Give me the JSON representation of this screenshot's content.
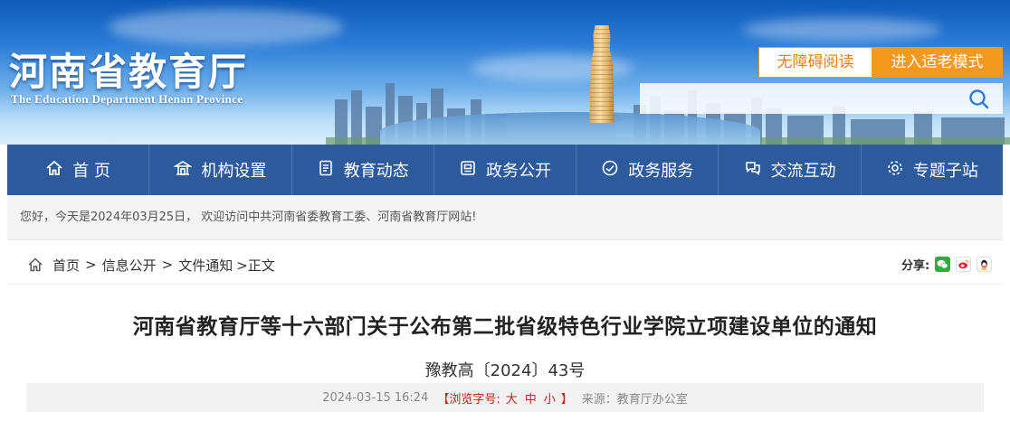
{
  "header": {
    "site_title": "河南省教育厅",
    "site_subtitle": "The Education Department Henan Province",
    "accessibility_label": "无障碍阅读",
    "elder_mode_label": "进入适老模式",
    "search_value": ""
  },
  "nav": {
    "items": [
      {
        "label": "首 页",
        "icon": "home-icon"
      },
      {
        "label": "机构设置",
        "icon": "building-icon"
      },
      {
        "label": "教育动态",
        "icon": "news-icon"
      },
      {
        "label": "政务公开",
        "icon": "document-icon"
      },
      {
        "label": "政务服务",
        "icon": "service-icon"
      },
      {
        "label": "交流互动",
        "icon": "chat-icon"
      },
      {
        "label": "专题子站",
        "icon": "gear-icon"
      }
    ]
  },
  "welcome": {
    "text": "您好，今天是2024年03月25日， 欢迎访问中共河南省委教育工委、河南省教育厅网站!"
  },
  "breadcrumb": {
    "home": "首页",
    "level1": "信息公开",
    "level2": "文件通知",
    "current": ">正文",
    "separator": ">"
  },
  "share": {
    "label": "分享:",
    "icons": [
      "wechat-icon",
      "weibo-icon",
      "qq-icon"
    ]
  },
  "article": {
    "title": "河南省教育厅等十六部门关于公布第二批省级特色行业学院立项建设单位的通知",
    "doc_number": "豫教高〔2024〕43号",
    "date": "2024-03-15 16:24",
    "font_size_prefix": "【浏览字号:",
    "size_large": "大",
    "size_medium": "中",
    "size_small": "小",
    "font_size_suffix": "】",
    "source": "来源：教育厅办公室"
  },
  "colors": {
    "nav_bg": "#2c5a9b",
    "accent_orange": "#f39a1c",
    "red": "#c81e1e"
  }
}
